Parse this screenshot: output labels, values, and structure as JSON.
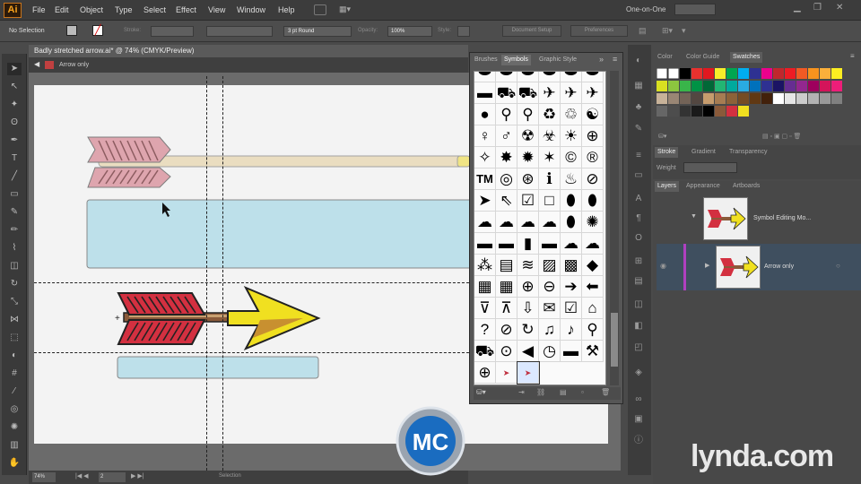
{
  "app": {
    "logo": "Ai",
    "workspace": "One-on-One"
  },
  "menu": [
    "File",
    "Edit",
    "Object",
    "Type",
    "Select",
    "Effect",
    "View",
    "Window",
    "Help"
  ],
  "control_bar": {
    "selection_status": "No Selection",
    "stroke_label": "Stroke:",
    "brush_label": "3 pt Round",
    "opacity_label": "Opacity:",
    "opacity_value": "100%",
    "style_label": "Style:",
    "document_setup": "Document Setup",
    "preferences": "Preferences"
  },
  "document": {
    "tab_title": "Badly stretched arrow.ai* @ 74% (CMYK/Preview)",
    "breadcrumb": "Arrow only",
    "zoom": "74%",
    "page": "2",
    "status_tool": "Selection"
  },
  "symbols_panel": {
    "tabs": [
      "Brushes",
      "Symbols",
      "Graphic Style"
    ],
    "active_tab": "Symbols",
    "symbol_count": 66
  },
  "right_panel": {
    "top_tabs": [
      "Color",
      "Color Guide",
      "Swatches"
    ],
    "active_top_tab": "Swatches",
    "mid_tabs": [
      "Stroke",
      "Gradient",
      "Transparency"
    ],
    "weight_label": "Weight",
    "layer_tabs": [
      "Layers",
      "Appearance",
      "Artboards"
    ],
    "layers": [
      {
        "name": "Symbol Editing Mo..."
      },
      {
        "name": "Arrow only"
      }
    ]
  },
  "watermark": {
    "brand": "lynda.com",
    "logo_text": "MC"
  },
  "colors": {
    "arrow_fletching": "#e04050",
    "arrow_head": "#f0e020",
    "shaft": "#8a5a3a",
    "banner": "#bde0ea"
  }
}
